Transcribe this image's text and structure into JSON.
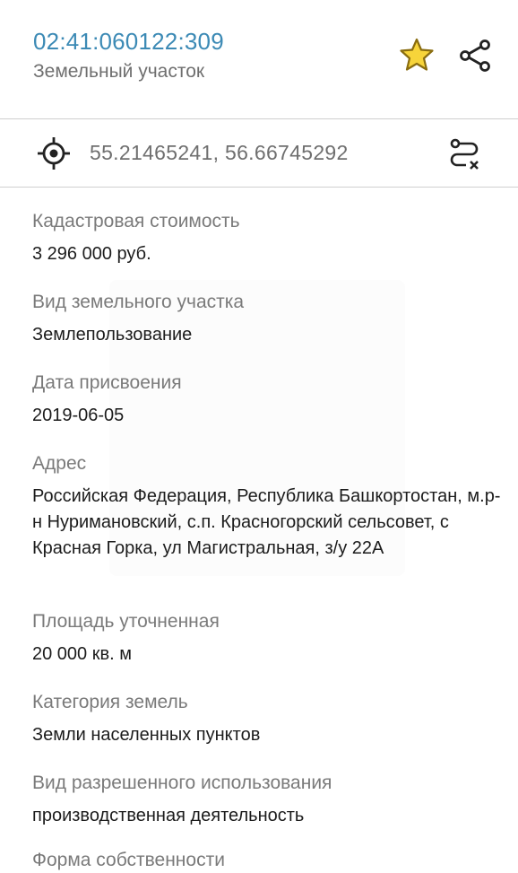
{
  "header": {
    "cadastral_number": "02:41:060122:309",
    "object_type": "Земельный участок",
    "favorite_icon": "star-icon",
    "share_icon": "share-icon",
    "accent_color": "#3c8ab5",
    "star_color": "#e6b71e"
  },
  "coords": {
    "value": "55.21465241, 56.66745292",
    "locate_icon": "target-icon",
    "route_icon": "route-icon"
  },
  "fields": [
    {
      "label": "Кадастровая стоимость",
      "value": "3 296 000 руб."
    },
    {
      "label": "Вид земельного участка",
      "value": "Землепользование"
    },
    {
      "label": "Дата присвоения",
      "value": "2019-06-05"
    },
    {
      "label": "Адрес",
      "value": "Российская Федерация, Республика Башкортостан, м.р-н Нуримановский, с.п. Красногорский сельсовет, с Красная Горка, ул Магистральная, з/у 22А"
    },
    {
      "label": "Площадь уточненная",
      "value": "20 000 кв. м"
    },
    {
      "label": "Категория земель",
      "value": "Земли населенных пунктов"
    },
    {
      "label": "Вид разрешенного использования",
      "value": "производственная деятельность"
    },
    {
      "label": "Форма собственности",
      "value": ""
    }
  ]
}
